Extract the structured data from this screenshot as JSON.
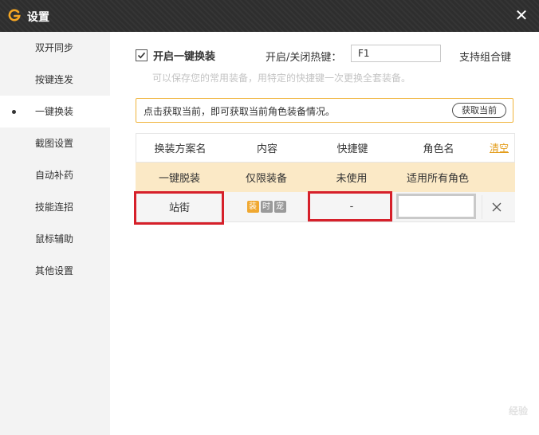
{
  "window": {
    "title": "设置",
    "close_icon": "close-icon",
    "logo_color": "#f5a623"
  },
  "sidebar": {
    "items": [
      {
        "label": "双开同步"
      },
      {
        "label": "按键连发"
      },
      {
        "label": "一键换装",
        "active": true
      },
      {
        "label": "截图设置"
      },
      {
        "label": "自动补药"
      },
      {
        "label": "技能连招"
      },
      {
        "label": "鼠标辅助"
      },
      {
        "label": "其他设置"
      }
    ]
  },
  "main": {
    "enable_label": "开启一键换装",
    "enable_checked": true,
    "hotkey_label": "开启/关闭热键：",
    "hotkey_value": "F1",
    "combo_label": "支持组合键",
    "hint": "可以保存您的常用装备，用特定的快捷键一次更换全套装备。",
    "notice": {
      "text": "点击获取当前，即可获取当前角色装备情况。",
      "button": "获取当前",
      "border_color": "#f0b43c"
    },
    "table": {
      "headers": [
        "换装方案名",
        "内容",
        "快捷键",
        "角色名"
      ],
      "clear_label": "清空",
      "rows": [
        {
          "name": "一键脱装",
          "content": "仅限装备",
          "hotkey": "未使用",
          "role": "适用所有角色"
        },
        {
          "name": "站街",
          "tags": [
            "装",
            "时",
            "宠"
          ],
          "hotkey": "-",
          "role": ""
        }
      ]
    }
  },
  "watermark": "经验",
  "colors": {
    "accent": "#e39c19",
    "highlight_red": "#d6202a",
    "row_highlight": "#fbe9c6"
  }
}
